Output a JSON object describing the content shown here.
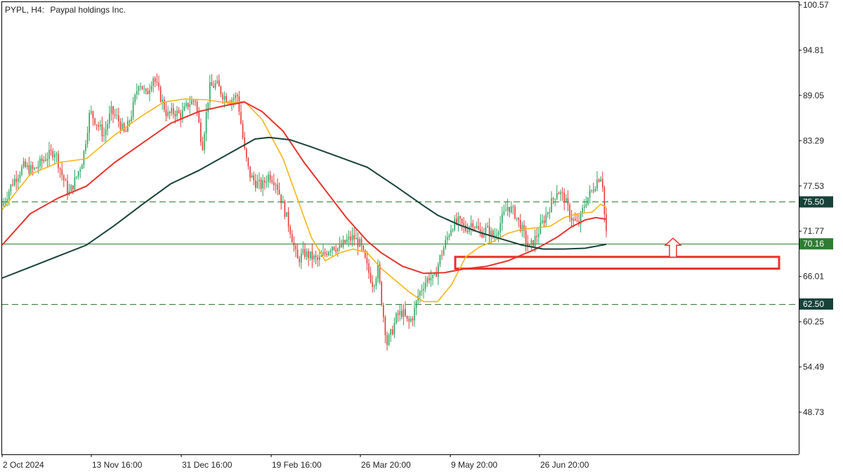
{
  "header": {
    "symbol": "PYPL, H4:",
    "description": "Paypal holdings Inc."
  },
  "colors": {
    "bull": "#26a65b",
    "bear": "#e53935",
    "ma_fast": "#f7b515",
    "ma_mid": "#e8322b",
    "ma_slow": "#17423a",
    "level_line": "#2e7d32",
    "zone": "#e8322b",
    "arrow": "#e8322b",
    "axis": "#000000",
    "badge_green": "#2e7d32",
    "badge_dark": "#17423a"
  },
  "chart_data": {
    "type": "candlestick",
    "title": "PYPL, H4:  Paypal holdings Inc.",
    "x_ticks": [
      "2 Oct 2024",
      "13 Nov 16:00",
      "31 Dec 16:00",
      "19 Feb 16:00",
      "26 Mar 20:00",
      "9 May 20:00",
      "26 Jun 20:00"
    ],
    "y_ticks": [
      "100.57",
      "94.81",
      "89.05",
      "83.29",
      "77.53",
      "71.77",
      "66.01",
      "60.25",
      "54.49",
      "48.73"
    ],
    "ylim": [
      43.0,
      100.57
    ],
    "horizontal_levels": [
      {
        "value": 75.5,
        "label": "75.50",
        "style": "dashed"
      },
      {
        "value": 70.16,
        "label": "70.16",
        "style": "solid"
      },
      {
        "value": 62.5,
        "label": "62.50",
        "style": "dashed"
      }
    ],
    "support_zone": {
      "low": 67.0,
      "high": 68.5
    },
    "arrow_up_at": 70.16,
    "moving_averages": [
      {
        "color": "yellow",
        "points": [
          [
            0,
            74.5
          ],
          [
            40,
            79
          ],
          [
            80,
            80.5
          ],
          [
            120,
            81
          ],
          [
            160,
            84
          ],
          [
            200,
            86.5
          ],
          [
            230,
            88.2
          ],
          [
            260,
            88.6
          ],
          [
            290,
            88.5
          ],
          [
            320,
            88.1
          ],
          [
            345,
            88.3
          ],
          [
            370,
            86
          ],
          [
            400,
            81
          ],
          [
            420,
            76
          ],
          [
            440,
            71
          ],
          [
            460,
            68
          ],
          [
            480,
            69
          ],
          [
            500,
            69.5
          ],
          [
            520,
            69
          ],
          [
            540,
            67
          ],
          [
            560,
            65.5
          ],
          [
            580,
            64
          ],
          [
            600,
            62.8
          ],
          [
            620,
            62.8
          ],
          [
            640,
            65
          ],
          [
            660,
            68.5
          ],
          [
            680,
            69.8
          ],
          [
            700,
            70.5
          ],
          [
            720,
            71.5
          ],
          [
            740,
            72
          ],
          [
            760,
            72.2
          ],
          [
            780,
            72.4
          ],
          [
            800,
            73.5
          ],
          [
            820,
            74
          ],
          [
            840,
            74.2
          ],
          [
            852,
            75.2
          ],
          [
            860,
            74.8
          ]
        ]
      },
      {
        "color": "red",
        "points": [
          [
            0,
            70
          ],
          [
            40,
            74
          ],
          [
            80,
            76
          ],
          [
            120,
            77.5
          ],
          [
            160,
            80.5
          ],
          [
            200,
            83
          ],
          [
            240,
            85.5
          ],
          [
            280,
            87
          ],
          [
            320,
            87.8
          ],
          [
            345,
            88.2
          ],
          [
            370,
            87
          ],
          [
            400,
            84.5
          ],
          [
            430,
            80.5
          ],
          [
            460,
            77
          ],
          [
            490,
            73.5
          ],
          [
            520,
            70.5
          ],
          [
            540,
            69
          ],
          [
            570,
            67.3
          ],
          [
            600,
            66.4
          ],
          [
            630,
            66.5
          ],
          [
            660,
            67
          ],
          [
            690,
            67.3
          ],
          [
            720,
            68
          ],
          [
            760,
            69.5
          ],
          [
            790,
            71
          ],
          [
            810,
            72.3
          ],
          [
            830,
            73.2
          ],
          [
            845,
            73.5
          ],
          [
            860,
            73.3
          ]
        ]
      },
      {
        "color": "dark",
        "points": [
          [
            0,
            65.8
          ],
          [
            40,
            67.2
          ],
          [
            80,
            68.6
          ],
          [
            120,
            70
          ],
          [
            160,
            72.5
          ],
          [
            200,
            75.2
          ],
          [
            240,
            77.8
          ],
          [
            280,
            79.5
          ],
          [
            320,
            81.5
          ],
          [
            360,
            83.5
          ],
          [
            380,
            83.7
          ],
          [
            410,
            83.4
          ],
          [
            440,
            82.5
          ],
          [
            480,
            81.2
          ],
          [
            520,
            79.9
          ],
          [
            560,
            77.5
          ],
          [
            600,
            75
          ],
          [
            620,
            73.8
          ],
          [
            650,
            72.6
          ],
          [
            680,
            71.6
          ],
          [
            710,
            70.8
          ],
          [
            740,
            70
          ],
          [
            770,
            69.5
          ],
          [
            800,
            69.5
          ],
          [
            830,
            69.6
          ],
          [
            860,
            70.1
          ]
        ]
      }
    ],
    "price_path": [
      [
        0,
        75
      ],
      [
        15,
        78
      ],
      [
        30,
        80
      ],
      [
        45,
        79.5
      ],
      [
        60,
        81
      ],
      [
        75,
        82
      ],
      [
        85,
        79
      ],
      [
        95,
        76.5
      ],
      [
        105,
        78.5
      ],
      [
        115,
        81
      ],
      [
        125,
        87
      ],
      [
        135,
        85.5
      ],
      [
        145,
        84
      ],
      [
        155,
        87
      ],
      [
        165,
        86
      ],
      [
        175,
        84
      ],
      [
        185,
        87
      ],
      [
        195,
        91
      ],
      [
        205,
        89
      ],
      [
        215,
        91.5
      ],
      [
        225,
        89
      ],
      [
        235,
        86.5
      ],
      [
        245,
        87
      ],
      [
        255,
        86.5
      ],
      [
        265,
        88
      ],
      [
        275,
        88.5
      ],
      [
        285,
        82.5
      ],
      [
        295,
        90
      ],
      [
        305,
        90.5
      ],
      [
        315,
        89
      ],
      [
        325,
        88.5
      ],
      [
        335,
        89
      ],
      [
        345,
        82
      ],
      [
        352,
        79
      ],
      [
        360,
        78
      ],
      [
        370,
        77.5
      ],
      [
        380,
        79
      ],
      [
        390,
        78
      ],
      [
        400,
        75
      ],
      [
        410,
        72
      ],
      [
        420,
        68
      ],
      [
        430,
        69
      ],
      [
        440,
        68.5
      ],
      [
        450,
        68
      ],
      [
        460,
        69
      ],
      [
        470,
        70
      ],
      [
        480,
        69.5
      ],
      [
        490,
        70.5
      ],
      [
        500,
        71
      ],
      [
        510,
        70
      ],
      [
        520,
        67
      ],
      [
        528,
        65
      ],
      [
        535,
        67
      ],
      [
        542,
        61.5
      ],
      [
        548,
        57.5
      ],
      [
        555,
        59
      ],
      [
        562,
        61
      ],
      [
        570,
        61.5
      ],
      [
        578,
        60
      ],
      [
        585,
        61
      ],
      [
        592,
        63.5
      ],
      [
        600,
        65
      ],
      [
        608,
        66
      ],
      [
        615,
        65.5
      ],
      [
        622,
        68
      ],
      [
        630,
        70
      ],
      [
        640,
        72.5
      ],
      [
        650,
        73
      ],
      [
        660,
        72
      ],
      [
        670,
        73
      ],
      [
        680,
        71.5
      ],
      [
        690,
        72
      ],
      [
        700,
        71
      ],
      [
        710,
        73
      ],
      [
        720,
        75
      ],
      [
        730,
        74
      ],
      [
        740,
        72
      ],
      [
        750,
        69.5
      ],
      [
        760,
        71
      ],
      [
        770,
        73
      ],
      [
        780,
        75
      ],
      [
        790,
        77
      ],
      [
        800,
        76
      ],
      [
        810,
        73.5
      ],
      [
        820,
        72.5
      ],
      [
        830,
        75.5
      ],
      [
        840,
        77
      ],
      [
        848,
        78.5
      ],
      [
        854,
        79
      ],
      [
        858,
        73
      ],
      [
        862,
        70.3
      ]
    ]
  }
}
